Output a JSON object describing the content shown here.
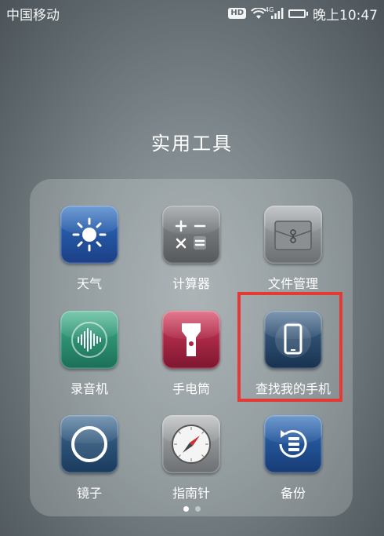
{
  "status_bar": {
    "carrier": "中国移动",
    "hd_badge": "HD",
    "network_type": "4G",
    "time": "晚上10:47",
    "battery_level": 0.85
  },
  "folder": {
    "title": "实用工具",
    "apps": [
      {
        "label": "天气",
        "icon": "weather-sun-icon"
      },
      {
        "label": "计算器",
        "icon": "calculator-icon"
      },
      {
        "label": "文件管理",
        "icon": "file-manager-icon"
      },
      {
        "label": "录音机",
        "icon": "recorder-icon"
      },
      {
        "label": "手电筒",
        "icon": "flashlight-icon"
      },
      {
        "label": "查找我的手机",
        "icon": "find-phone-icon"
      },
      {
        "label": "镜子",
        "icon": "mirror-icon"
      },
      {
        "label": "指南针",
        "icon": "compass-icon"
      },
      {
        "label": "备份",
        "icon": "backup-icon"
      }
    ],
    "highlighted_app": "查找我的手机"
  },
  "pagination": {
    "current": 1,
    "total": 2
  },
  "colors": {
    "highlight": "#e53935"
  }
}
